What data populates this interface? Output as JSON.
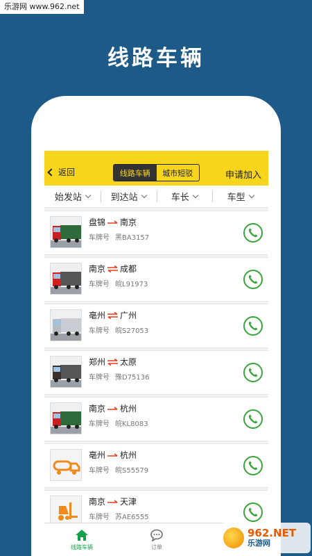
{
  "watermark": {
    "site": "乐游网 www.962.net",
    "brand_main": "962.NET",
    "brand_sub": "乐游网"
  },
  "promo_title": "线路车辆",
  "topbar": {
    "back_label": "返回",
    "tabs": [
      {
        "label": "线路车辆",
        "active": true
      },
      {
        "label": "城市短驳",
        "active": false
      }
    ],
    "apply_label": "申请加入"
  },
  "filters": [
    "始发站",
    "到达站",
    "车长",
    "车型"
  ],
  "plate_label": "车牌号",
  "vehicles": [
    {
      "from": "盘锦",
      "to": "南京",
      "round_trip": false,
      "plate": "黑BA3157",
      "truck": "red-box-truck"
    },
    {
      "from": "南京",
      "to": "成都",
      "round_trip": true,
      "plate": "皖L91973",
      "truck": "red-tractor"
    },
    {
      "from": "亳州",
      "to": "广州",
      "round_trip": true,
      "plate": "皖S27053",
      "truck": "silver-box-truck"
    },
    {
      "from": "郑州",
      "to": "太原",
      "round_trip": true,
      "plate": "豫D75136",
      "truck": "black-tractor"
    },
    {
      "from": "南京",
      "to": "杭州",
      "round_trip": false,
      "plate": "皖KL8083",
      "truck": "red-box-truck"
    },
    {
      "from": "亳州",
      "to": "杭州",
      "round_trip": false,
      "plate": "皖S55579",
      "truck": "orange-tanker-icon"
    },
    {
      "from": "南京",
      "to": "天津",
      "round_trip": false,
      "plate": "苏AE6555",
      "truck": "orange-forklift-icon"
    }
  ],
  "tabbar": [
    {
      "label": "线路车辆",
      "active": true
    },
    {
      "label": "订单",
      "active": false
    }
  ],
  "colors": {
    "accent": "#f7d51d",
    "active_green": "#17a04a",
    "call_green": "#3aa53a",
    "arrow_red": "#e53c1f",
    "background": "#1e5a87"
  }
}
